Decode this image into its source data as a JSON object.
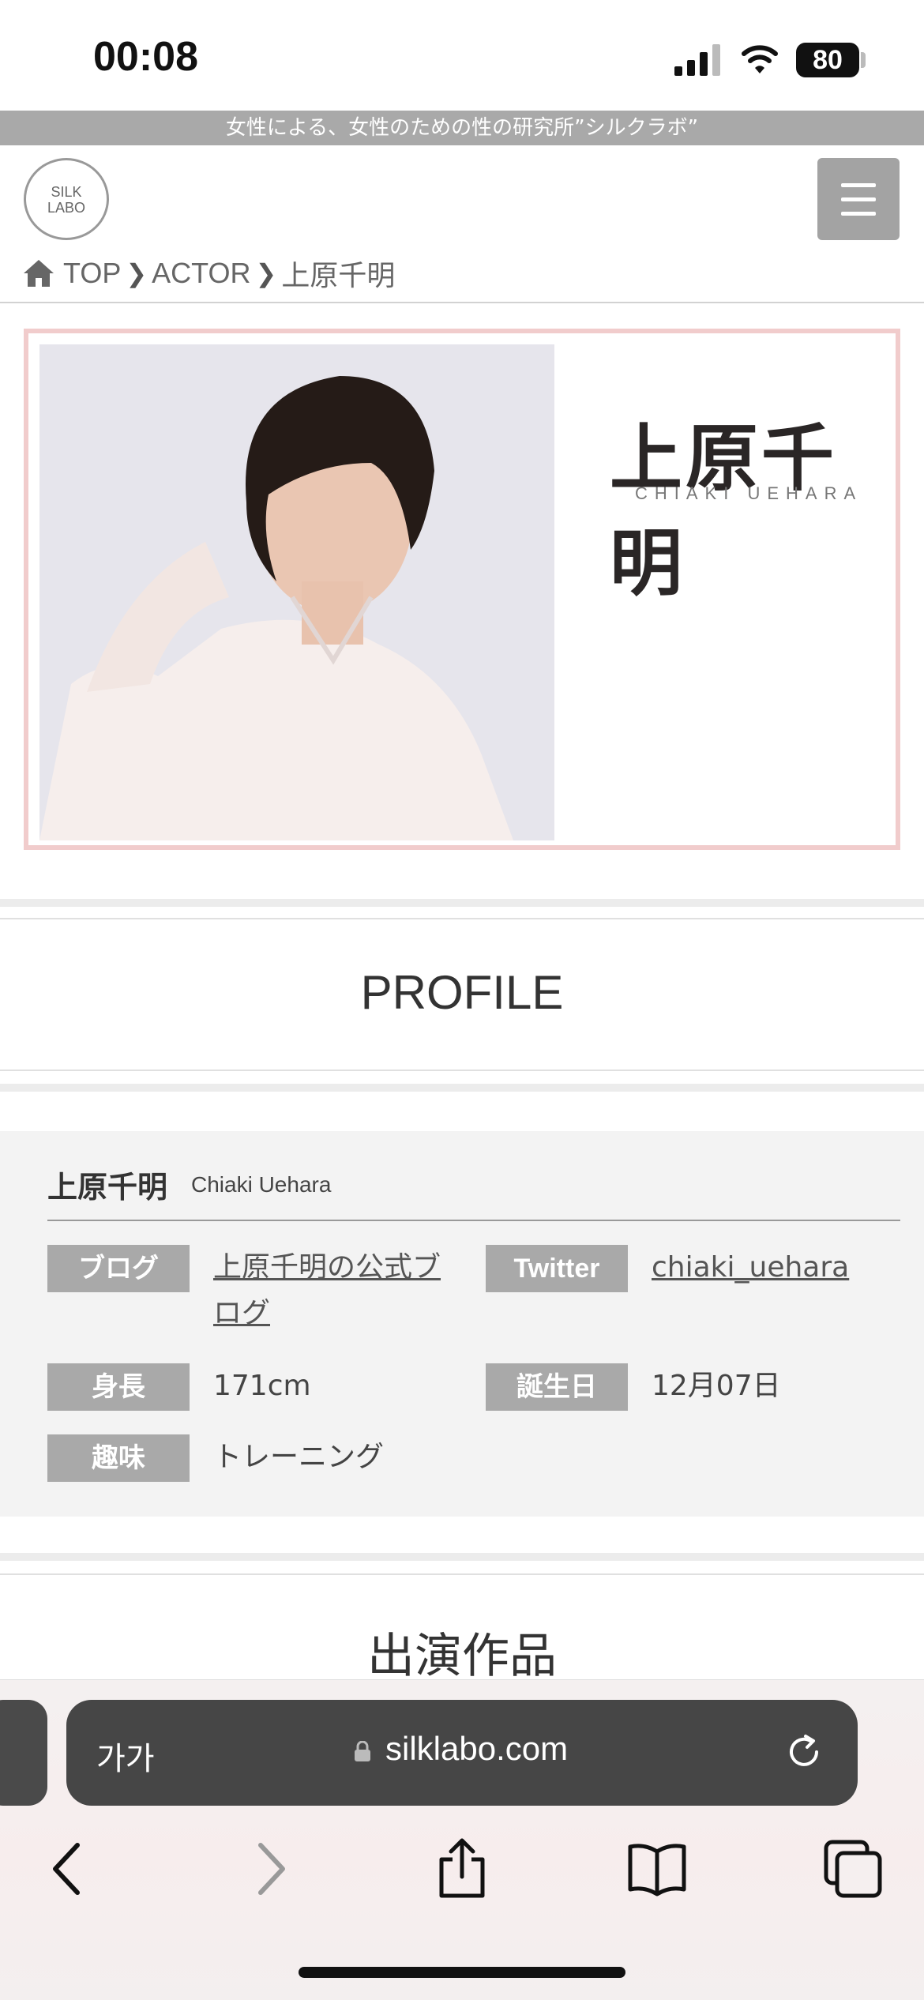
{
  "status": {
    "time": "00:08",
    "battery": "80"
  },
  "tagline": "女性による、女性のための性の研究所”シルクラボ”",
  "logo": {
    "line1": "SILK",
    "line2": "LABO"
  },
  "breadcrumb": {
    "home": "TOP",
    "section": "ACTOR",
    "current": "上原千明"
  },
  "hero": {
    "name": "上原千明",
    "roman": "CHIAKI UEHARA"
  },
  "profile": {
    "heading": "PROFILE",
    "name": "上原千明",
    "name_en": "Chiaki Uehara",
    "fields": {
      "blog_label": "ブログ",
      "blog_value": "上原千明の公式ブログ",
      "twitter_label": "Twitter",
      "twitter_value": "chiaki_uehara",
      "height_label": "身長",
      "height_value": "171cm",
      "birthday_label": "誕生日",
      "birthday_value": "12月07日",
      "hobby_label": "趣味",
      "hobby_value": "トレーニング"
    }
  },
  "works": {
    "heading": "出演作品"
  },
  "browser": {
    "aa": "가가",
    "url": "silklabo.com"
  },
  "colors": {
    "frame": "#f1cccc",
    "label_bg": "#a9a9a9",
    "panel_bg": "#f3f3f3",
    "urlbar": "#464646"
  },
  "icons": [
    "home-icon",
    "menu-icon",
    "lock-icon",
    "reload-icon",
    "back-icon",
    "forward-icon",
    "share-icon",
    "bookmarks-icon",
    "tabs-icon"
  ]
}
